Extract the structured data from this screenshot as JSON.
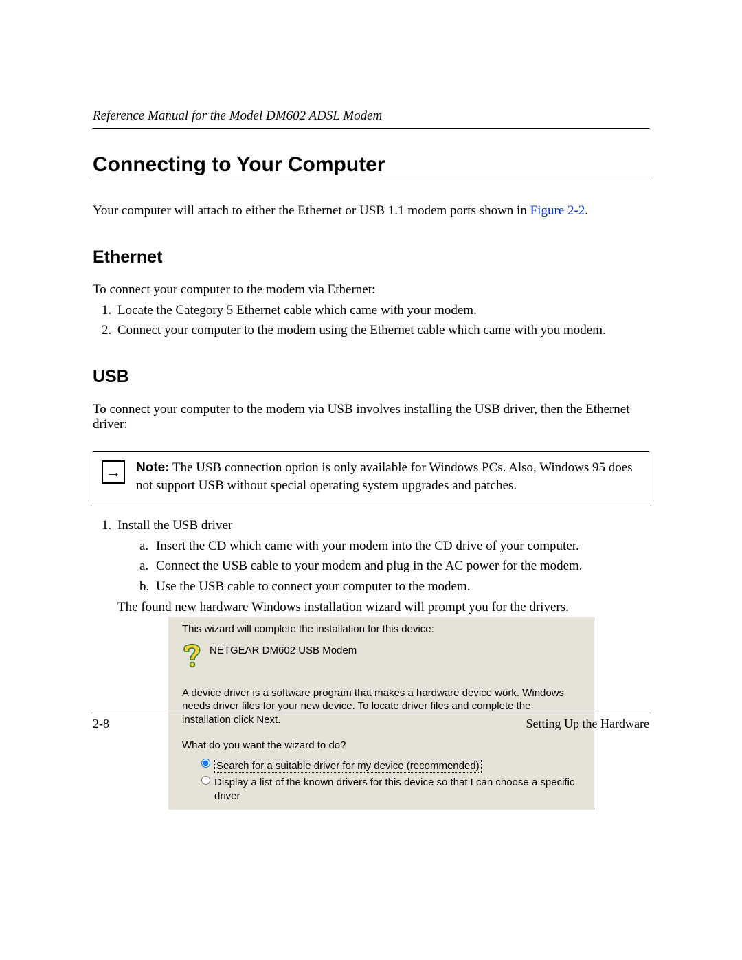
{
  "header": "Reference Manual for the Model DM602 ADSL Modem",
  "title": "Connecting to Your Computer",
  "intro_pre": "Your computer will attach to either the Ethernet or USB 1.1 modem ports shown in ",
  "intro_link": "Figure 2-2",
  "intro_post": ".",
  "ethernet": {
    "heading": "Ethernet",
    "lead": "To connect your computer to the modem via Ethernet:",
    "items": [
      "Locate the Category 5 Ethernet cable which came with your modem.",
      "Connect your computer to the modem using the Ethernet cable which came with you modem."
    ]
  },
  "usb": {
    "heading": "USB",
    "lead": "To connect your computer to the modem via USB involves installing the USB driver, then the Ethernet driver:"
  },
  "note": {
    "label": "Note:",
    "text": " The USB connection option is only available for Windows PCs. Also, Windows 95 does not support USB without special operating system upgrades and patches."
  },
  "install": {
    "step1": "Install the USB driver",
    "sub": [
      {
        "label": "a.",
        "text": "Insert the CD which came with your modem into the CD drive of your computer."
      },
      {
        "label": "a.",
        "text": "Connect the USB cable to your modem and plug in the AC power for the modem."
      },
      {
        "label": "b.",
        "text": "Use the USB cable to connect your computer to the modem."
      }
    ],
    "continuation": "The found new hardware Windows installation wizard will prompt you for the drivers."
  },
  "wizard": {
    "line1": "This wizard will complete the installation for this device:",
    "device": "NETGEAR DM602 USB Modem",
    "explain": "A device driver is a software program that makes a hardware device work. Windows needs driver files for your new device. To locate driver files and complete the installation click Next.",
    "question": "What do you want the wizard to do?",
    "opt1": "Search for a suitable driver for my device (recommended)",
    "opt2": "Display a list of the known drivers for this device so that I can choose a specific driver"
  },
  "footer": {
    "left": "2-8",
    "right": "Setting Up the Hardware"
  }
}
